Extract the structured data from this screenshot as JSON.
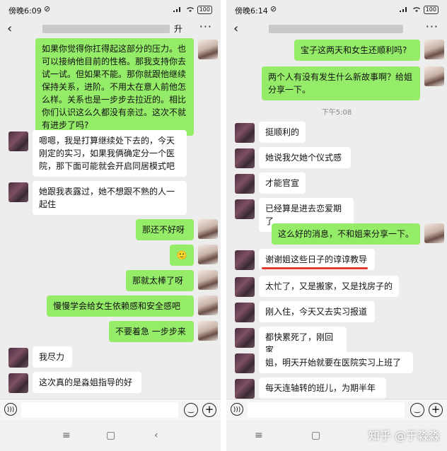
{
  "left": {
    "status": {
      "time": "傍晚6:09",
      "battery": "100"
    },
    "title_tail": "升",
    "messages": [
      {
        "side": "me",
        "text": "如果你觉得你扛得起这部分的压力。也可以接纳他目前的性格。那我支持你去试一试。但如果不能。那你就跟他继续保持关系，进阶。不用太在意人前他怎么样。关系也是一步步去拉近的。相比你们认识这么久都没有亲过。这次不就有进步了吗?"
      },
      {
        "side": "them",
        "text": "嗯嗯，我是打算继续处下去的，今天刚定的实习，如果我俩确定分一个医院，那下面可能就会开启同居模式吧"
      },
      {
        "side": "them",
        "text": "她跟我表露过，她不想跟不熟的人一起住"
      },
      {
        "side": "me",
        "text": "那还不好呀"
      },
      {
        "side": "me",
        "text": "🙂"
      },
      {
        "side": "me",
        "text": "那就太棒了呀"
      },
      {
        "side": "me",
        "text": "慢慢学会给女生依赖感和安全感吧"
      },
      {
        "side": "me",
        "text": "不要着急 一步步来"
      },
      {
        "side": "them",
        "text": "我尽力"
      },
      {
        "side": "them",
        "text": "这次真的是淼姐指导的好"
      }
    ]
  },
  "right": {
    "status": {
      "time": "傍晚6:14",
      "battery": "100"
    },
    "timestamp": "下午5:08",
    "messages": [
      {
        "side": "me",
        "text": "宝子这两天和女生还顺利吗?"
      },
      {
        "side": "me",
        "text": "两个人有没有发生什么新故事啊？给姐分享一下。"
      },
      {
        "side": "them",
        "text": "挺顺利的"
      },
      {
        "side": "them",
        "text": "她说我欠她个仪式感"
      },
      {
        "side": "them",
        "text": "才能官宣"
      },
      {
        "side": "them",
        "text": "已经算是进去恋爱期了"
      },
      {
        "side": "me",
        "text": "这么好的消息，不和姐来分享一下。"
      },
      {
        "side": "them",
        "text": "谢谢姐这些日子的谆谆教导"
      },
      {
        "side": "them",
        "text": "太忙了，又是搬家，又是找房子的"
      },
      {
        "side": "them",
        "text": "刚入住，今天又去实习报道"
      },
      {
        "side": "them",
        "text": "都快累死了，刚回家"
      },
      {
        "side": "them",
        "text": "姐，明天开始就要在医院实习上班了"
      },
      {
        "side": "them",
        "text": "每天连轴转的班儿，为期半年"
      }
    ]
  },
  "watermark": "知乎 @于淼淼",
  "icons": {
    "back": "back-arrow-icon",
    "more": "more-dots-icon",
    "voice": "voice-icon",
    "emoji": "emoji-icon",
    "plus": "plus-icon",
    "wifi": "wifi-icon",
    "signal": "signal-icon",
    "alarm": "alarm-icon",
    "battery": "battery-icon"
  },
  "colors": {
    "green_bubble": "#95ec69",
    "white_bubble": "#ffffff",
    "chat_bg": "#ededed",
    "underline": "#e03b2e"
  }
}
